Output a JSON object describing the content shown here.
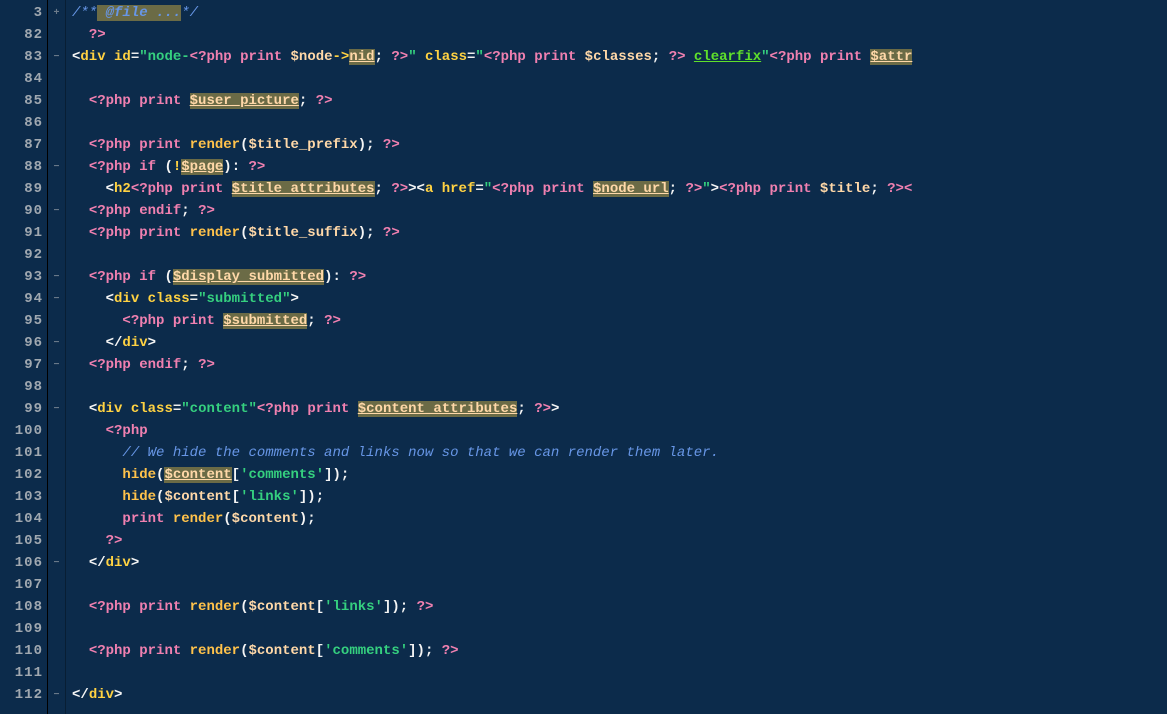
{
  "line_numbers": [
    "3",
    "82",
    "83",
    "84",
    "85",
    "86",
    "87",
    "88",
    "89",
    "90",
    "91",
    "92",
    "93",
    "94",
    "95",
    "96",
    "97",
    "98",
    "99",
    "100",
    "101",
    "102",
    "103",
    "104",
    "105",
    "106",
    "107",
    "108",
    "109",
    "110",
    "111",
    "112"
  ],
  "fold_markers": [
    "+",
    "",
    "−",
    "",
    "",
    "",
    "",
    "−",
    "",
    "−",
    "",
    "",
    "−",
    "−",
    "",
    "−",
    "−",
    "",
    "−",
    "",
    "",
    "",
    "",
    "",
    "",
    "−",
    "",
    "",
    "",
    "",
    "",
    "−"
  ],
  "lines": {
    "l3": {
      "comment_open": "/**",
      "comment_mid": " @file ...",
      "comment_close": "*/"
    },
    "l82": {
      "open": "?>"
    },
    "l83": {
      "t1": "<",
      "tag": "div",
      "sp": " ",
      "a1": "id",
      "eq": "=",
      "q": "\"",
      "s1": "node-",
      "po": "<?php ",
      "pr": "print ",
      "v1": "$node",
      "arrow": "->",
      "nid": "nid",
      "sc": "; ",
      "pc": "?>",
      "q2": "\"",
      " sp2": " ",
      "a2": "class",
      "eq2": "=",
      "q3": "\"",
      "po2": "<?php ",
      "pr2": "print ",
      "v2": "$classes",
      "sc2": ";",
      "sp3": " ",
      "pc2": "?>",
      "sp4": " ",
      "cf": "clearfix",
      "q4": "\"",
      "po3": "<?php ",
      "pr3": "print ",
      "attr": "$attr"
    },
    "l85": {
      "po": "<?php ",
      "pr": "print ",
      "var": "$user_picture",
      "sc": "; ",
      "pc": "?>"
    },
    "l87": {
      "po": "<?php ",
      "pr": "print ",
      "fn": "render",
      "op": "(",
      "var": "$title_prefix",
      "cp": ")",
      "sc": "; ",
      "pc": "?>"
    },
    "l88": {
      "po": "<?php ",
      "if": "if ",
      "op": "(",
      "neg": "!",
      "var": "$page",
      "cp": ")",
      "colon": ": ",
      "pc": "?>"
    },
    "l89": {
      "t1": "<",
      "tag": "h2",
      "po": "<?php ",
      "pr": "print ",
      "var": "$title_attributes",
      "sc": "; ",
      "pc": "?>",
      "t2": ">",
      "t3": "<",
      "tag2": "a",
      "sp": " ",
      "a1": "href",
      "eq": "=",
      "q": "\"",
      "po2": "<?php ",
      "pr2": "print ",
      "var2": "$node_url",
      "sc2": "; ",
      "pc2": "?>",
      "q2": "\"",
      "t4": ">",
      "po3": "<?php ",
      "pr3": "print ",
      "var3": "$title",
      "sc3": "; ",
      "pc3": "?><"
    },
    "l90": {
      "po": "<?php ",
      "end": "endif",
      "sc": "; ",
      "pc": "?>"
    },
    "l91": {
      "po": "<?php ",
      "pr": "print ",
      "fn": "render",
      "op": "(",
      "var": "$title_suffix",
      "cp": ")",
      "sc": "; ",
      "pc": "?>"
    },
    "l93": {
      "po": "<?php ",
      "if": "if ",
      "op": "(",
      "var": "$display_submitted",
      "cp": ")",
      "colon": ": ",
      "pc": "?>"
    },
    "l94": {
      "t1": "<",
      "tag": "div",
      "sp": " ",
      "a1": "class",
      "eq": "=",
      "q": "\"",
      "s": "submitted",
      "q2": "\"",
      "t2": ">"
    },
    "l95": {
      "po": "<?php ",
      "pr": "print ",
      "var": "$submitted",
      "sc": "; ",
      "pc": "?>"
    },
    "l96": {
      "t1": "</",
      "tag": "div",
      "t2": ">"
    },
    "l97": {
      "po": "<?php ",
      "end": "endif",
      "sc": "; ",
      "pc": "?>"
    },
    "l99": {
      "t1": "<",
      "tag": "div",
      "sp": " ",
      "a1": "class",
      "eq": "=",
      "q": "\"",
      "s": "content",
      "q2": "\"",
      "po": "<?php ",
      "pr": "print ",
      "var": "$content_attributes",
      "sc": "; ",
      "pc": "?>",
      "t2": ">",
      "t3": ">"
    },
    "l100": {
      "po": "<?php"
    },
    "l101": {
      "c": "// We hide the comments and links now so that we can render them later."
    },
    "l102": {
      "fn": "hide",
      "op": "(",
      "var": "$content",
      "br": "[",
      "q": "'",
      "s": "comments",
      "q2": "'",
      "br2": "]",
      "cp": ")",
      "sc": ";"
    },
    "l103": {
      "fn": "hide",
      "op": "(",
      "var": "$content",
      "br": "[",
      "q": "'",
      "s": "links",
      "q2": "'",
      "br2": "]",
      "cp": ")",
      "sc": ";"
    },
    "l104": {
      "pr": "print ",
      "fn": "render",
      "op": "(",
      "var": "$content",
      "cp": ")",
      "sc": ";"
    },
    "l105": {
      "pc": "?>"
    },
    "l106": {
      "t1": "</",
      "tag": "div",
      "t2": ">"
    },
    "l108": {
      "po": "<?php ",
      "pr": "print ",
      "fn": "render",
      "op": "(",
      "var": "$content",
      "br": "[",
      "q": "'",
      "s": "links",
      "q2": "'",
      "br2": "]",
      "cp": ")",
      "sc": "; ",
      "pc": "?>"
    },
    "l110": {
      "po": "<?php ",
      "pr": "print ",
      "fn": "render",
      "op": "(",
      "var": "$content",
      "br": "[",
      "q": "'",
      "s": "comments",
      "q2": "'",
      "br2": "]",
      "cp": ")",
      "sc": "; ",
      "pc": "?>"
    },
    "l112": {
      "t1": "</",
      "tag": "div",
      "t2": ">"
    }
  }
}
